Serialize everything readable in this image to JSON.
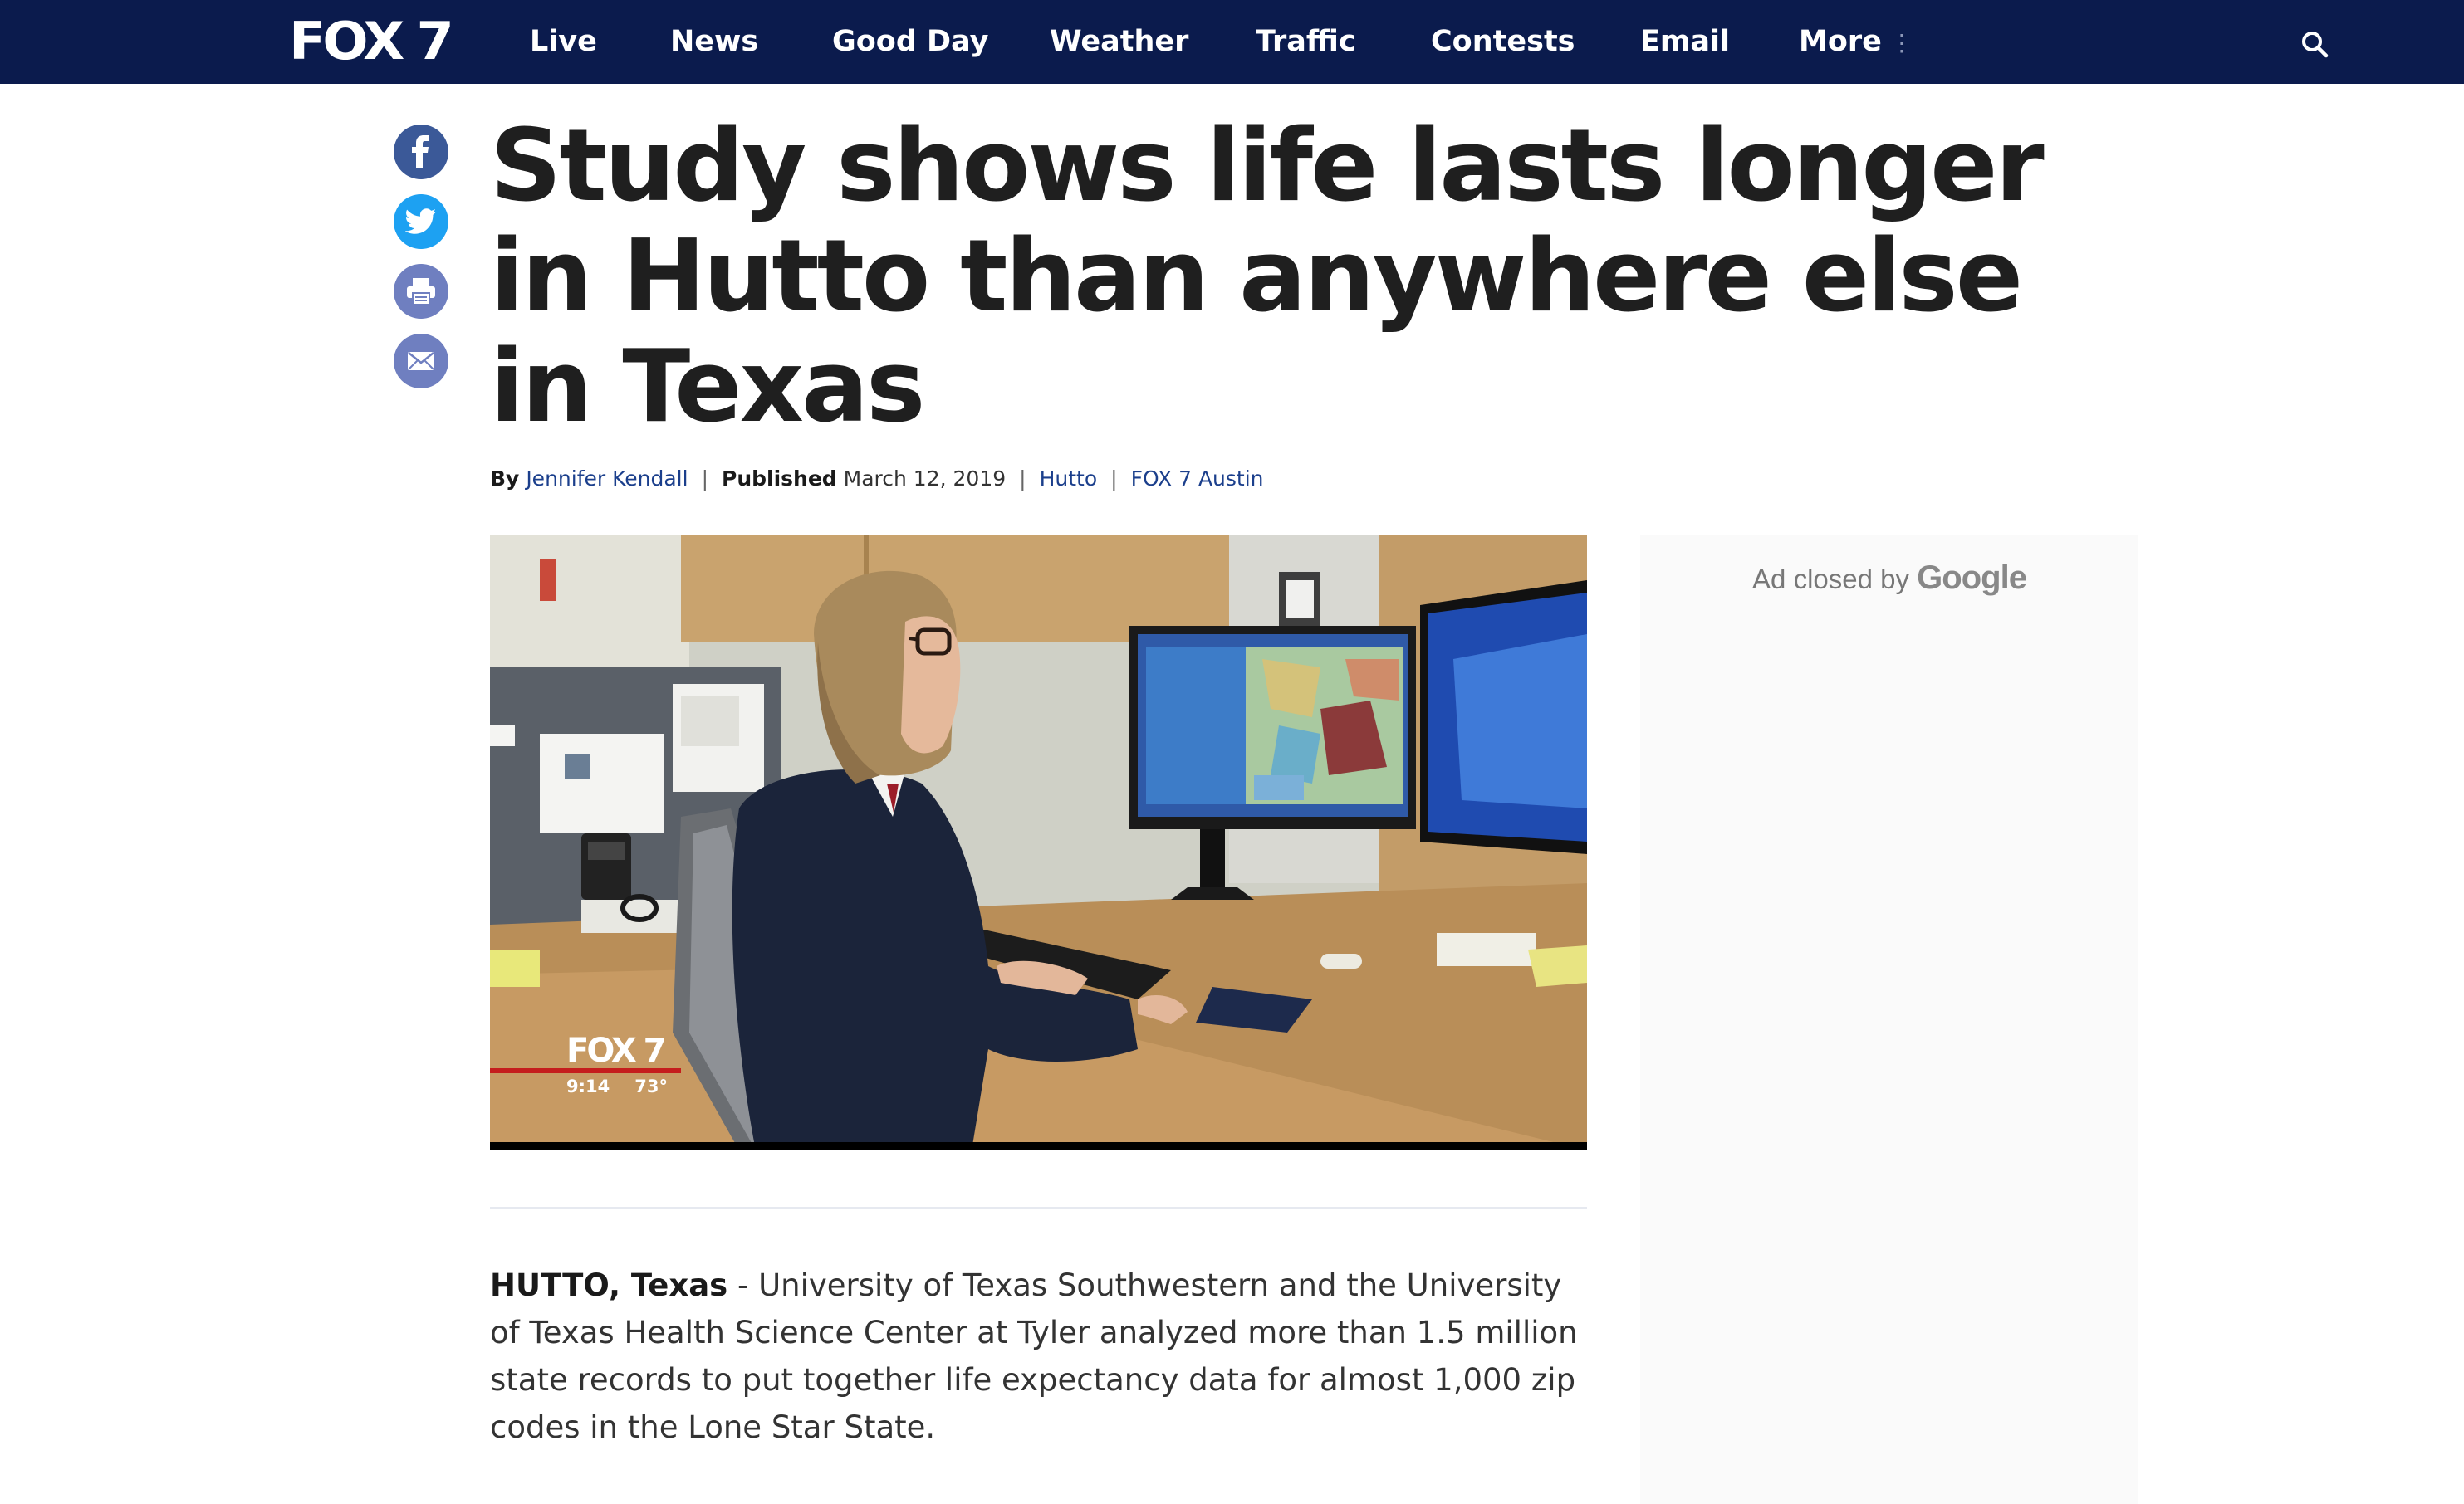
{
  "nav": {
    "logo": "FOX 7",
    "items": [
      "Live",
      "News",
      "Good Day",
      "Weather",
      "Traffic",
      "Contests",
      "Email",
      "More"
    ],
    "more_glyph": "⋮",
    "search_icon": "search-icon",
    "background": "#0b1b4d"
  },
  "share": {
    "icons": [
      "facebook-icon",
      "twitter-icon",
      "print-icon",
      "email-icon"
    ],
    "colors": {
      "facebook": "#3b5998",
      "twitter": "#1da1f2",
      "print": "#6f7fc0",
      "email": "#6f7fc0"
    }
  },
  "article": {
    "headline": "Study shows life lasts longer in Hutto than anywhere else in Texas",
    "byline_label": "By",
    "author": "Jennifer Kendall",
    "published_label": "Published",
    "published_date": "March 12, 2019",
    "tag": "Hutto",
    "source": "FOX 7 Austin",
    "dateline": "HUTTO, Texas",
    "body": " - University of Texas Southwestern and the University of Texas Health Science Center at Tyler analyzed more than 1.5 million state records to put together life expectancy data for almost 1,000 zip codes in the Lone Star State."
  },
  "video": {
    "bug_logo": "FOX 7",
    "bug_time": "9:14",
    "bug_temp": "73°"
  },
  "ad": {
    "closed_by": "Ad closed by",
    "brand": "Google"
  }
}
